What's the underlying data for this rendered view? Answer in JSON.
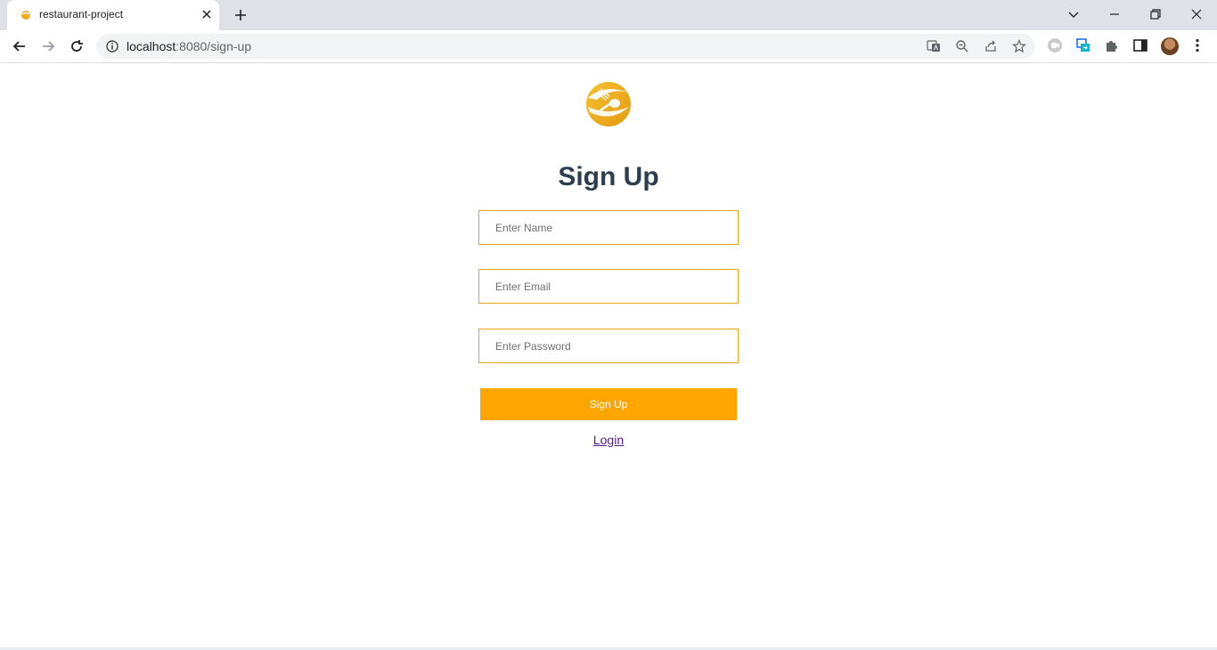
{
  "browser": {
    "tab_title": "restaurant-project",
    "url_host": "localhost",
    "url_path": ":8080/sign-up"
  },
  "page": {
    "heading": "Sign Up",
    "name_placeholder": "Enter Name",
    "email_placeholder": "Enter Email",
    "password_placeholder": "Enter Password",
    "submit_label": "Sign Up",
    "login_link": "Login"
  },
  "colors": {
    "accent": "#ffa500",
    "input_border": "#e8a317",
    "heading": "#2c3e50"
  }
}
